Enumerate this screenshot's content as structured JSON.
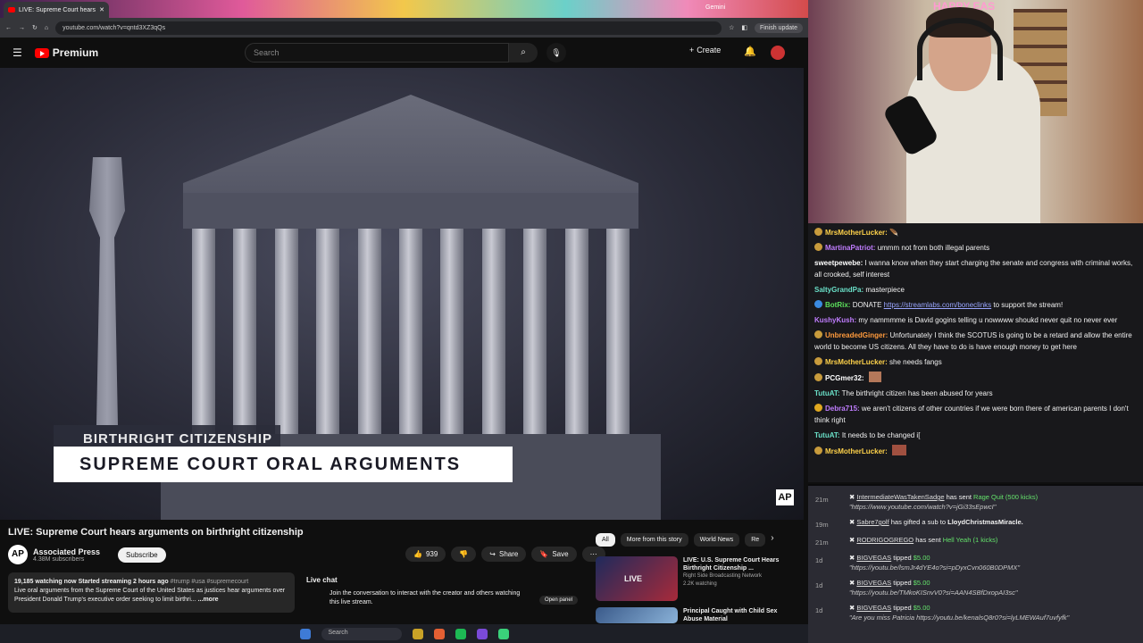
{
  "browser": {
    "tab_title": "LIVE: Supreme Court hears",
    "gemini_label": "Gemini",
    "url": "youtube.com/watch?v=qntd3XZ3qQs",
    "finish_update": "Finish update"
  },
  "youtube": {
    "logo": "Premium",
    "search_placeholder": "Search",
    "create_label": "Create"
  },
  "video": {
    "lower_third_top": "BIRTHRIGHT CITIZENSHIP",
    "lower_third_main": "SUPREME COURT ORAL ARGUMENTS",
    "watermark": "AP"
  },
  "details": {
    "title": "LIVE: Supreme Court hears arguments on birthright citizenship",
    "channel": "Associated Press",
    "subscribers": "4.38M subscribers",
    "subscribe": "Subscribe",
    "likes": "939",
    "share": "Share",
    "save": "Save",
    "desc_stats": "19,185 watching now  Started streaming 2 hours ago",
    "desc_tags": "#trump #usa #supremecourt",
    "desc_text": "Live oral arguments from the Supreme Court of the United States as justices hear arguments over President Donald Trump's executive order seeking to limit birthri...",
    "more": "...more",
    "live_chat_title": "Live chat",
    "live_chat_text": "Join the conversation to interact with the creator and others watching this live stream.",
    "open_panel": "Open panel"
  },
  "chips": [
    "All",
    "More from this story",
    "World News",
    "Re"
  ],
  "recommendations": [
    {
      "title": "LIVE: U.S. Supreme Court Hears Birthright Citizenship ...",
      "channel": "Right Side Broadcasting Network",
      "meta": "2.2K watching",
      "badge": "LIVE"
    },
    {
      "title": "Principal Caught with Child Sex Abuse Material",
      "channel": "",
      "meta": "",
      "badge": ""
    }
  ],
  "webcam": {
    "sign": "HAPPY EAS"
  },
  "chat": [
    {
      "user": "MrsMotherLucker:",
      "color": "#ffd24a",
      "text": ""
    },
    {
      "user": "MartinaPatriot:",
      "color": "#c07dff",
      "text": "ummm not from both illegal parents"
    },
    {
      "user": "sweetpewebe:",
      "color": "#ffffff",
      "text": "I wanna know when they start charging the senate and congress with criminal works, all crooked, self interest"
    },
    {
      "user": "SaltyGrandPa:",
      "color": "#6ae0c8",
      "text": "masterpiece"
    },
    {
      "user": "BotRix:",
      "color": "#5ce05c",
      "text": "DONATE ",
      "link": "https://streamlabs.com/boneclinks",
      "after": " to support the stream!"
    },
    {
      "user": "KushyKush:",
      "color": "#c07dff",
      "text": "my nammmme is David gogins telling u nowwww shoukd never quit no never ever"
    },
    {
      "user": "UnbreadedGinger:",
      "color": "#ff9a3c",
      "text": "Unfortunately I think the SCOTUS is going to be a retard and allow the entire world to become US citizens. All they have to do is have enough money to get here"
    },
    {
      "user": "MrsMotherLucker:",
      "color": "#ffd24a",
      "text": "she needs fangs"
    },
    {
      "user": "PCGmer32:",
      "color": "#ffffff",
      "text": ""
    },
    {
      "user": "TutuAT:",
      "color": "#6ae0c8",
      "text": "The birthright citizen has been abused for years"
    },
    {
      "user": "Debra715:",
      "color": "#c07dff",
      "text": "we aren't citizens of other countries if we were born there of american parents I don't think right"
    },
    {
      "user": "TutuAT:",
      "color": "#6ae0c8",
      "text": "It needs to be changed i["
    },
    {
      "user": "MrsMotherLucker:",
      "color": "#ffd24a",
      "text": ""
    }
  ],
  "events": [
    {
      "time": "21m",
      "user": "IntermediateWasTakenSadge",
      "action": "has sent",
      "highlight": "Rage Quit (500 kicks)",
      "link": "\"https://www.youtube.com/watch?v=jGi33sEpwcI\""
    },
    {
      "time": "19m",
      "user": "Sabre7golf",
      "action": "has gifted a sub to",
      "highlight": "LloydChristmasMiracle.",
      "link": ""
    },
    {
      "time": "21m",
      "user": "RODRIGOGREGO",
      "action": "has sent",
      "highlight": "Hell Yeah (1 kicks)",
      "link": ""
    },
    {
      "time": "1d",
      "user": "BIGVEGAS",
      "action": "tipped",
      "highlight": "$5.00",
      "link": "\"https://youtu.be/lsmJr4dYE4o?si=pDyxCvn060B0DPMX\""
    },
    {
      "time": "1d",
      "user": "BIGVEGAS",
      "action": "tipped",
      "highlight": "$5.00",
      "link": "\"https://youtu.be/TMkoKISnvV0?si=AAN4SBfDxopAI3sc\""
    },
    {
      "time": "1d",
      "user": "BIGVEGAS",
      "action": "tipped",
      "highlight": "$5.00",
      "link": "\"Are you miss Patricia https://youtu.be/kenalsQ8r0?si=lyLMEWAuf7uvfyfk\""
    }
  ],
  "taskbar": {
    "search": "Search"
  }
}
